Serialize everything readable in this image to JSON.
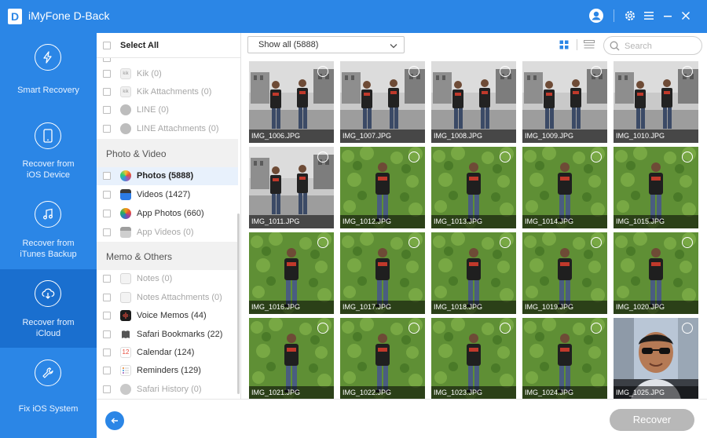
{
  "app": {
    "title": "iMyFone D-Back",
    "logo_letter": "D",
    "accent_color": "#2b86e6"
  },
  "nav": [
    {
      "label": "Smart Recovery",
      "icon": "lightning-circle-icon",
      "active": false
    },
    {
      "label": "Recover from\niOS Device",
      "icon": "phone-icon",
      "active": false
    },
    {
      "label": "Recover from\niTunes Backup",
      "icon": "music-note-icon",
      "active": false
    },
    {
      "label": "Recover from\niCloud",
      "icon": "cloud-download-icon",
      "active": true
    },
    {
      "label": "Fix iOS System",
      "icon": "wrench-icon",
      "active": false
    }
  ],
  "categories": {
    "select_all": "Select All",
    "top_items": [
      {
        "label": "Kik (0)",
        "icon": "kik-icon",
        "disabled": true
      },
      {
        "label": "Kik Attachments (0)",
        "icon": "kik-icon",
        "disabled": true
      },
      {
        "label": "LINE (0)",
        "icon": "line-icon",
        "disabled": true
      },
      {
        "label": "LINE Attachments (0)",
        "icon": "line-icon",
        "disabled": true
      }
    ],
    "sections": [
      {
        "title": "Photo & Video",
        "items": [
          {
            "label": "Photos (5888)",
            "icon": "photos-icon",
            "disabled": false,
            "selected": true
          },
          {
            "label": "Videos (1427)",
            "icon": "videos-icon",
            "disabled": false
          },
          {
            "label": "App Photos (660)",
            "icon": "app-photos-icon",
            "disabled": false
          },
          {
            "label": "App Videos (0)",
            "icon": "app-videos-icon",
            "disabled": true
          }
        ]
      },
      {
        "title": "Memo & Others",
        "items": [
          {
            "label": "Notes (0)",
            "icon": "notes-icon",
            "disabled": true
          },
          {
            "label": "Notes Attachments (0)",
            "icon": "notes-icon",
            "disabled": true
          },
          {
            "label": "Voice Memos (44)",
            "icon": "voice-memos-icon",
            "disabled": false
          },
          {
            "label": "Safari Bookmarks (22)",
            "icon": "bookmark-icon",
            "disabled": false
          },
          {
            "label": "Calendar (124)",
            "icon": "calendar-icon",
            "disabled": false
          },
          {
            "label": "Reminders (129)",
            "icon": "reminders-icon",
            "disabled": false
          },
          {
            "label": "Safari History (0)",
            "icon": "safari-icon",
            "disabled": true
          }
        ]
      }
    ]
  },
  "toolbar": {
    "filter_value": "Show all (5888)",
    "search_placeholder": "Search"
  },
  "photos": [
    {
      "name": "IMG_1006.JPG",
      "scene": "street"
    },
    {
      "name": "IMG_1007.JPG",
      "scene": "street"
    },
    {
      "name": "IMG_1008.JPG",
      "scene": "street"
    },
    {
      "name": "IMG_1009.JPG",
      "scene": "street"
    },
    {
      "name": "IMG_1010.JPG",
      "scene": "street"
    },
    {
      "name": "IMG_1011.JPG",
      "scene": "street"
    },
    {
      "name": "IMG_1012.JPG",
      "scene": "hedge"
    },
    {
      "name": "IMG_1013.JPG",
      "scene": "hedge"
    },
    {
      "name": "IMG_1014.JPG",
      "scene": "hedge"
    },
    {
      "name": "IMG_1015.JPG",
      "scene": "hedge"
    },
    {
      "name": "IMG_1016.JPG",
      "scene": "hedge"
    },
    {
      "name": "IMG_1017.JPG",
      "scene": "hedge"
    },
    {
      "name": "IMG_1018.JPG",
      "scene": "hedge"
    },
    {
      "name": "IMG_1019.JPG",
      "scene": "hedge"
    },
    {
      "name": "IMG_1020.JPG",
      "scene": "hedge"
    },
    {
      "name": "IMG_1021.JPG",
      "scene": "hedge"
    },
    {
      "name": "IMG_1022.JPG",
      "scene": "hedge"
    },
    {
      "name": "IMG_1023.JPG",
      "scene": "hedge"
    },
    {
      "name": "IMG_1024.JPG",
      "scene": "hedge"
    },
    {
      "name": "IMG_1025.JPG",
      "scene": "selfie"
    }
  ],
  "footer": {
    "recover_label": "Recover"
  }
}
